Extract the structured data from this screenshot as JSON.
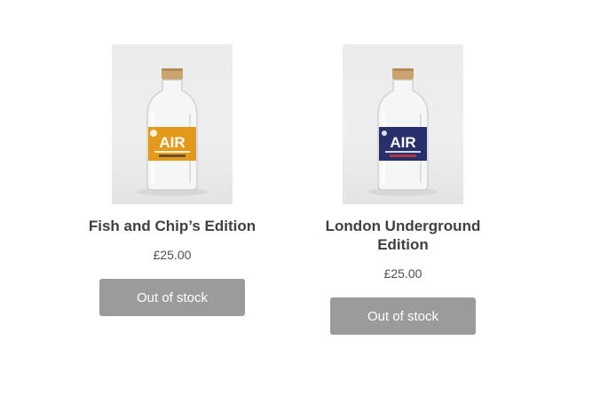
{
  "products": [
    {
      "title": "Fish and Chip’s Edition",
      "price": "£25.00",
      "button_label": "Out of stock",
      "label_color": "#e39a1b",
      "label_text": "AIR"
    },
    {
      "title": "London Underground Edition",
      "price": "£25.00",
      "button_label": "Out of stock",
      "label_color": "#27306b",
      "label_text": "AIR"
    }
  ],
  "colors": {
    "title_text": "#404040",
    "button_bg": "#9b9b9b",
    "button_text": "#ffffff"
  }
}
